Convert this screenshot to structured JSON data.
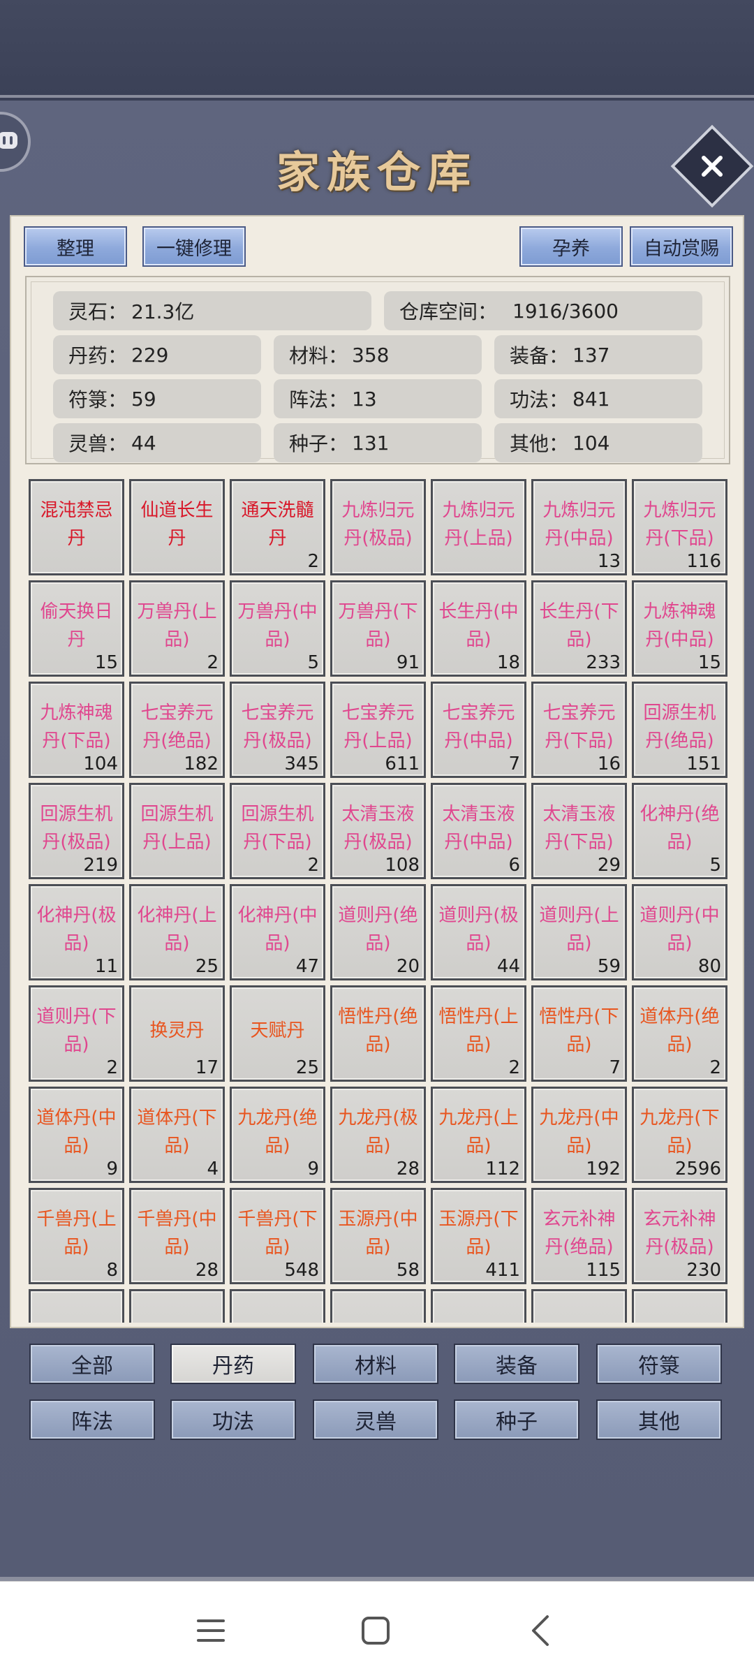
{
  "title": "家族仓库",
  "colors": {
    "accent_blue": "#8ea9db",
    "item_red": "#d8182a",
    "item_pink": "#e0468e",
    "item_orange": "#e8551f",
    "panel_bg": "#f1ece2"
  },
  "toolbar": {
    "organize": "整理",
    "repair_all": "一键修理",
    "nurture": "孕养",
    "auto_reward": "自动赏赐"
  },
  "stats": {
    "spirit_stone": {
      "label": "灵石：",
      "value": "21.3亿"
    },
    "capacity": {
      "label": "仓库空间：",
      "value": "1916/3600"
    },
    "pills": {
      "label": "丹药：",
      "value": "229"
    },
    "materials": {
      "label": "材料：",
      "value": "358"
    },
    "equipment": {
      "label": "装备：",
      "value": "137"
    },
    "talismans": {
      "label": "符箓：",
      "value": "59"
    },
    "formations": {
      "label": "阵法：",
      "value": "13"
    },
    "techniques": {
      "label": "功法：",
      "value": "841"
    },
    "beasts": {
      "label": "灵兽：",
      "value": "44"
    },
    "seeds": {
      "label": "种子：",
      "value": "131"
    },
    "others": {
      "label": "其他：",
      "value": "104"
    }
  },
  "items": [
    {
      "name": "混沌禁忌丹",
      "count": "",
      "color": "red"
    },
    {
      "name": "仙道长生丹",
      "count": "",
      "color": "red"
    },
    {
      "name": "通天洗髓丹",
      "count": "2",
      "color": "red"
    },
    {
      "name": "九炼归元丹(极品)",
      "count": "",
      "color": "pink"
    },
    {
      "name": "九炼归元丹(上品)",
      "count": "",
      "color": "pink"
    },
    {
      "name": "九炼归元丹(中品)",
      "count": "13",
      "color": "pink"
    },
    {
      "name": "九炼归元丹(下品)",
      "count": "116",
      "color": "pink"
    },
    {
      "name": "偷天换日丹",
      "count": "15",
      "color": "pink"
    },
    {
      "name": "万兽丹(上品)",
      "count": "2",
      "color": "pink"
    },
    {
      "name": "万兽丹(中品)",
      "count": "5",
      "color": "pink"
    },
    {
      "name": "万兽丹(下品)",
      "count": "91",
      "color": "pink"
    },
    {
      "name": "长生丹(中品)",
      "count": "18",
      "color": "pink"
    },
    {
      "name": "长生丹(下品)",
      "count": "233",
      "color": "pink"
    },
    {
      "name": "九炼神魂丹(中品)",
      "count": "15",
      "color": "pink"
    },
    {
      "name": "九炼神魂丹(下品)",
      "count": "104",
      "color": "pink"
    },
    {
      "name": "七宝养元丹(绝品)",
      "count": "182",
      "color": "pink"
    },
    {
      "name": "七宝养元丹(极品)",
      "count": "345",
      "color": "pink"
    },
    {
      "name": "七宝养元丹(上品)",
      "count": "611",
      "color": "pink"
    },
    {
      "name": "七宝养元丹(中品)",
      "count": "7",
      "color": "pink"
    },
    {
      "name": "七宝养元丹(下品)",
      "count": "16",
      "color": "pink"
    },
    {
      "name": "回源生机丹(绝品)",
      "count": "151",
      "color": "pink"
    },
    {
      "name": "回源生机丹(极品)",
      "count": "219",
      "color": "pink"
    },
    {
      "name": "回源生机丹(上品)",
      "count": "",
      "color": "pink"
    },
    {
      "name": "回源生机丹(下品)",
      "count": "2",
      "color": "pink"
    },
    {
      "name": "太清玉液丹(极品)",
      "count": "108",
      "color": "pink"
    },
    {
      "name": "太清玉液丹(中品)",
      "count": "6",
      "color": "pink"
    },
    {
      "name": "太清玉液丹(下品)",
      "count": "29",
      "color": "pink"
    },
    {
      "name": "化神丹(绝品)",
      "count": "5",
      "color": "pink"
    },
    {
      "name": "化神丹(极品)",
      "count": "11",
      "color": "pink"
    },
    {
      "name": "化神丹(上品)",
      "count": "25",
      "color": "pink"
    },
    {
      "name": "化神丹(中品)",
      "count": "47",
      "color": "pink"
    },
    {
      "name": "道则丹(绝品)",
      "count": "20",
      "color": "pink"
    },
    {
      "name": "道则丹(极品)",
      "count": "44",
      "color": "pink"
    },
    {
      "name": "道则丹(上品)",
      "count": "59",
      "color": "pink"
    },
    {
      "name": "道则丹(中品)",
      "count": "80",
      "color": "pink"
    },
    {
      "name": "道则丹(下品)",
      "count": "2",
      "color": "pink"
    },
    {
      "name": "换灵丹",
      "count": "17",
      "color": "orange"
    },
    {
      "name": "天赋丹",
      "count": "25",
      "color": "orange"
    },
    {
      "name": "悟性丹(绝品)",
      "count": "",
      "color": "orange"
    },
    {
      "name": "悟性丹(上品)",
      "count": "2",
      "color": "orange"
    },
    {
      "name": "悟性丹(下品)",
      "count": "7",
      "color": "orange"
    },
    {
      "name": "道体丹(绝品)",
      "count": "2",
      "color": "orange"
    },
    {
      "name": "道体丹(中品)",
      "count": "9",
      "color": "orange"
    },
    {
      "name": "道体丹(下品)",
      "count": "4",
      "color": "orange"
    },
    {
      "name": "九龙丹(绝品)",
      "count": "9",
      "color": "orange"
    },
    {
      "name": "九龙丹(极品)",
      "count": "28",
      "color": "orange"
    },
    {
      "name": "九龙丹(上品)",
      "count": "112",
      "color": "orange"
    },
    {
      "name": "九龙丹(中品)",
      "count": "192",
      "color": "orange"
    },
    {
      "name": "九龙丹(下品)",
      "count": "2596",
      "color": "orange"
    },
    {
      "name": "千兽丹(上品)",
      "count": "8",
      "color": "orange"
    },
    {
      "name": "千兽丹(中品)",
      "count": "28",
      "color": "orange"
    },
    {
      "name": "千兽丹(下品)",
      "count": "548",
      "color": "orange"
    },
    {
      "name": "玉源丹(中品)",
      "count": "58",
      "color": "orange"
    },
    {
      "name": "玉源丹(下品)",
      "count": "411",
      "color": "orange"
    },
    {
      "name": "玄元补神丹(绝品)",
      "count": "115",
      "color": "pink"
    },
    {
      "name": "玄元补神丹(极品)",
      "count": "230",
      "color": "pink"
    },
    {
      "name": "",
      "count": "",
      "color": "pink"
    },
    {
      "name": "",
      "count": "",
      "color": "pink"
    },
    {
      "name": "",
      "count": "",
      "color": "pink"
    },
    {
      "name": "",
      "count": "",
      "color": "pink"
    },
    {
      "name": "",
      "count": "",
      "color": "pink"
    },
    {
      "name": "",
      "count": "",
      "color": "pink"
    },
    {
      "name": "",
      "count": "",
      "color": "pink"
    }
  ],
  "tabs": [
    {
      "label": "全部",
      "active": false
    },
    {
      "label": "丹药",
      "active": true
    },
    {
      "label": "材料",
      "active": false
    },
    {
      "label": "装备",
      "active": false
    },
    {
      "label": "符箓",
      "active": false
    },
    {
      "label": "阵法",
      "active": false
    },
    {
      "label": "功法",
      "active": false
    },
    {
      "label": "灵兽",
      "active": false
    },
    {
      "label": "种子",
      "active": false
    },
    {
      "label": "其他",
      "active": false
    }
  ],
  "icons": {
    "chat": "chat-bubble-icon",
    "close": "close-icon",
    "nav_menu": "menu-icon",
    "nav_home": "home-square-icon",
    "nav_back": "back-chevron-icon"
  }
}
